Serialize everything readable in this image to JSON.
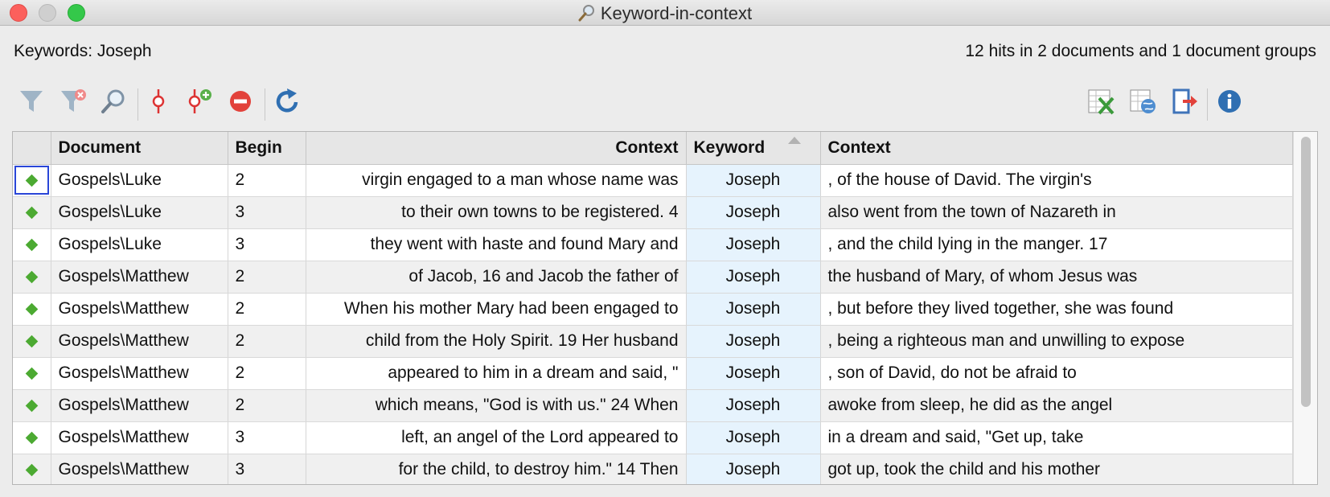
{
  "window": {
    "title": "Keyword-in-context"
  },
  "info": {
    "keywords": "Keywords: Joseph",
    "hits": "12 hits in 2 documents and 1 document groups"
  },
  "toolbar": {
    "left": [
      "filter-icon",
      "clear-filter-icon",
      "search-icon",
      "keyword-marker-icon",
      "add-keyword-icon",
      "remove-icon",
      "refresh-icon"
    ],
    "right": [
      "export-excel-icon",
      "export-html-icon",
      "export-icon",
      "info-icon"
    ]
  },
  "table": {
    "columns": [
      "",
      "Document",
      "Begin",
      "Context",
      "Keyword",
      "Context"
    ],
    "rows": [
      {
        "document": "Gospels\\Luke",
        "begin": "2",
        "context_left": "virgin engaged to a man whose name was",
        "keyword": "Joseph",
        "context_right": ", of the house of David. The virgin's"
      },
      {
        "document": "Gospels\\Luke",
        "begin": "3",
        "context_left": "to their own towns to be registered. 4",
        "keyword": "Joseph",
        "context_right": " also went from the town of Nazareth in"
      },
      {
        "document": "Gospels\\Luke",
        "begin": "3",
        "context_left": "they went with haste and found Mary and",
        "keyword": "Joseph",
        "context_right": ", and the child lying in the manger. 17"
      },
      {
        "document": "Gospels\\Matthew",
        "begin": "2",
        "context_left": "of Jacob, 16 and Jacob the father of",
        "keyword": "Joseph",
        "context_right": " the husband of Mary, of whom Jesus was"
      },
      {
        "document": "Gospels\\Matthew",
        "begin": "2",
        "context_left": "When his mother Mary had been engaged to",
        "keyword": "Joseph",
        "context_right": ", but before they lived together, she was found"
      },
      {
        "document": "Gospels\\Matthew",
        "begin": "2",
        "context_left": "child from the Holy Spirit. 19 Her husband",
        "keyword": "Joseph",
        "context_right": ", being a righteous man and unwilling to expose"
      },
      {
        "document": "Gospels\\Matthew",
        "begin": "2",
        "context_left": "appeared to him in a dream and said, \"",
        "keyword": "Joseph",
        "context_right": ", son of David, do not be afraid to"
      },
      {
        "document": "Gospels\\Matthew",
        "begin": "2",
        "context_left": "which means, \"God is with us.\" 24 When",
        "keyword": "Joseph",
        "context_right": " awoke from sleep, he did as the angel"
      },
      {
        "document": "Gospels\\Matthew",
        "begin": "3",
        "context_left": "left, an angel of the Lord appeared to",
        "keyword": "Joseph",
        "context_right": " in a dream and said, \"Get up, take"
      },
      {
        "document": "Gospels\\Matthew",
        "begin": "3",
        "context_left": "for the child, to destroy him.\" 14 Then",
        "keyword": "Joseph",
        "context_right": " got up, took the child and his mother"
      }
    ]
  },
  "colors": {
    "keyword_bg": "#e6f3fd",
    "marker": "#4caa32",
    "selection": "#2a46d8"
  }
}
